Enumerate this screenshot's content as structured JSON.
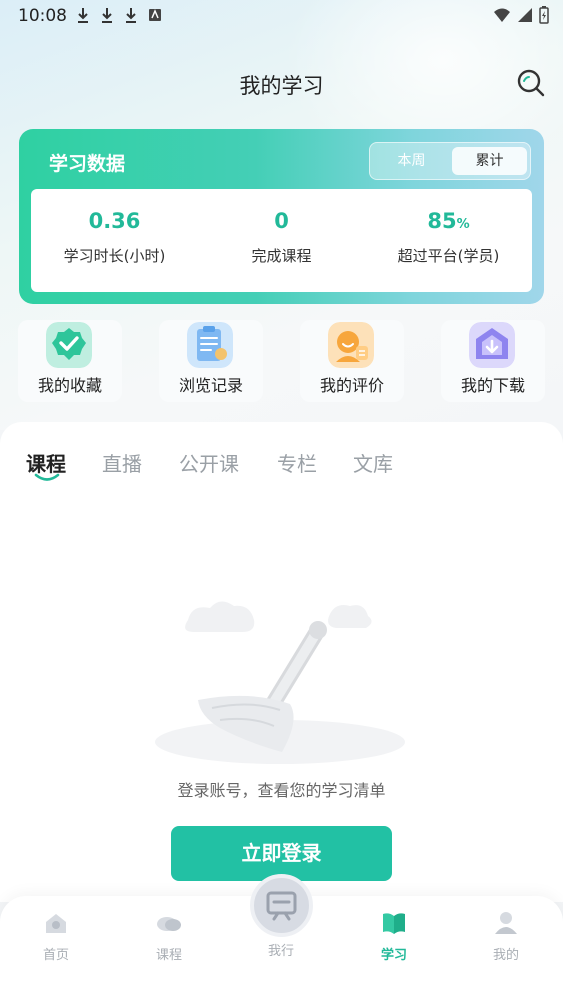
{
  "status_bar": {
    "time": "10:08",
    "left_icons": [
      "download-icon",
      "download-icon",
      "download-icon",
      "keyboard-icon"
    ],
    "right_icons": [
      "wifi-icon",
      "signal-icon",
      "battery-charging-icon"
    ]
  },
  "header": {
    "title": "我的学习",
    "search_icon": "search-icon"
  },
  "stats": {
    "title": "学习数据",
    "toggle": {
      "week": "本周",
      "total": "累计",
      "selected": "累计"
    },
    "items": [
      {
        "value": "0.36",
        "label": "学习时长(小时)"
      },
      {
        "value": "0",
        "label": "完成课程"
      },
      {
        "value": "85",
        "unit": "%",
        "label": "超过平台(学员)"
      }
    ]
  },
  "quick_actions": [
    {
      "label": "我的收藏",
      "icon": "check-badge-icon"
    },
    {
      "label": "浏览记录",
      "icon": "clipboard-icon"
    },
    {
      "label": "我的评价",
      "icon": "comment-person-icon"
    },
    {
      "label": "我的下载",
      "icon": "download-house-icon"
    }
  ],
  "tabs": [
    "课程",
    "直播",
    "公开课",
    "专栏",
    "文库"
  ],
  "active_tab": "课程",
  "empty_state": {
    "text": "登录账号，查看您的学习清单",
    "button": "立即登录"
  },
  "bottom_nav": [
    {
      "label": "首页",
      "icon": "home-icon"
    },
    {
      "label": "课程",
      "icon": "course-icon"
    },
    {
      "label": "我行",
      "icon": "board-icon"
    },
    {
      "label": "学习",
      "icon": "book-icon",
      "active": true
    },
    {
      "label": "我的",
      "icon": "profile-icon"
    }
  ],
  "colors": {
    "accent": "#22b999",
    "button": "#22c1a4",
    "card_start": "#2fd0a2",
    "card_end": "#a0d6ea"
  }
}
